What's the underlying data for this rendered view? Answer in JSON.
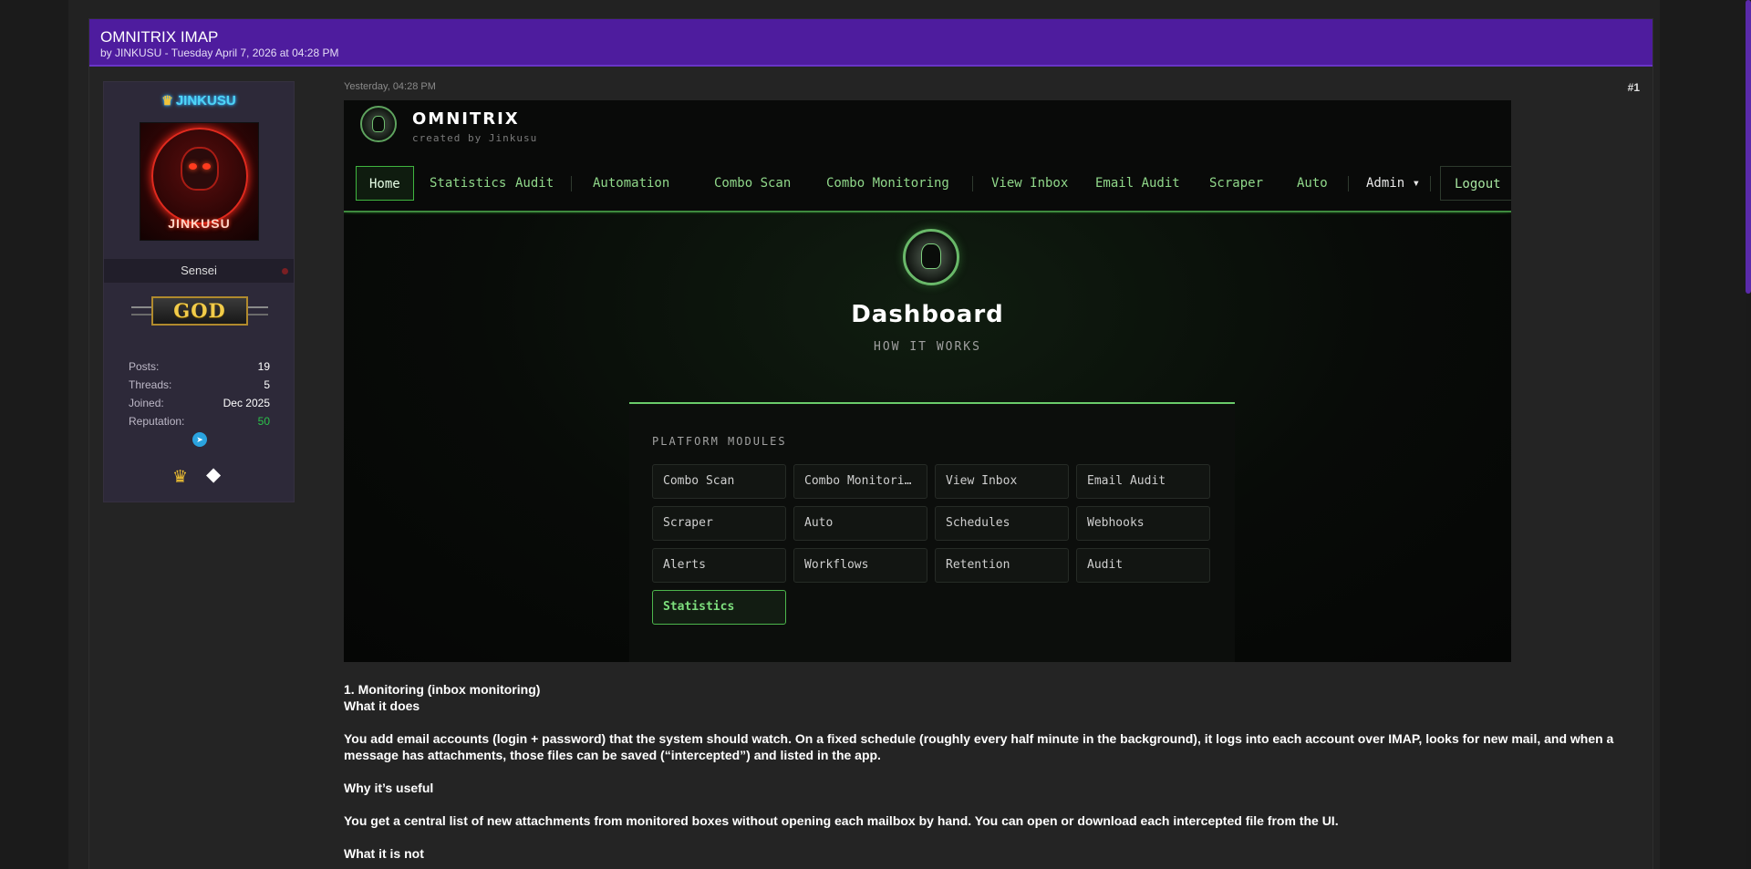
{
  "thread": {
    "title": "OMNITRIX IMAP",
    "byline": "by JINKUSU - Tuesday April 7, 2026 at 04:28 PM"
  },
  "user": {
    "name": "JINKUSU",
    "avatar_text": "JINKUSU",
    "title": "Sensei",
    "rank_badge": "GOD",
    "stats": [
      {
        "label": "Posts:",
        "value": "19"
      },
      {
        "label": "Threads:",
        "value": "5"
      },
      {
        "label": "Joined:",
        "value": "Dec 2025"
      },
      {
        "label": "Reputation:",
        "value": "50"
      }
    ],
    "colors": {
      "username": "#4fd6f5",
      "reputation": "#2bc24a"
    }
  },
  "post": {
    "date": "Yesterday, 04:28 PM",
    "number": "#1"
  },
  "app": {
    "title": "OMNITRIX",
    "subtitle": "created by Jinkusu",
    "nav": [
      "Home",
      "Statistics",
      "Audit",
      "Automation",
      "Combo Scan",
      "Combo Monitoring",
      "View Inbox",
      "Email Audit",
      "Scraper",
      "Auto",
      "Admin ▾",
      "Logout"
    ],
    "hero_title": "Dashboard",
    "hero_subtitle": "HOW IT WORKS",
    "modules_heading": "PLATFORM MODULES",
    "modules": [
      "Combo Scan",
      "Combo Monitoring",
      "View Inbox",
      "Email Audit",
      "Scraper",
      "Auto",
      "Schedules",
      "Webhooks",
      "Alerts",
      "Workflows",
      "Retention",
      "Audit",
      "Statistics"
    ],
    "accent_color": "#6acb6a"
  },
  "body": {
    "section_title": "1. Monitoring (inbox monitoring)",
    "what_it_does_label": "What it does",
    "what_it_does_text": "You add email accounts (login + password) that the system should watch. On a fixed schedule (roughly every half minute in the background), it logs into each account over IMAP, looks for new mail, and when a message has attachments, those files can be saved (“intercepted”) and listed in the app.",
    "why_label": "Why it’s useful",
    "why_text": "You get a central list of new attachments from monitored boxes without opening each mailbox by hand. You can open or download each intercepted file from the UI.",
    "not_label": "What it is not"
  }
}
